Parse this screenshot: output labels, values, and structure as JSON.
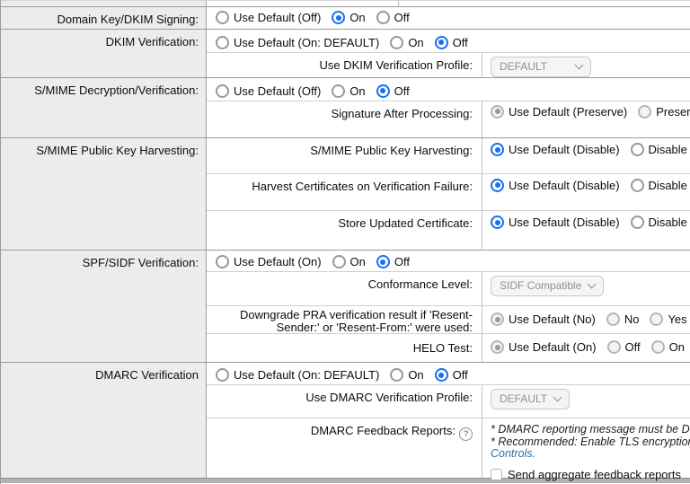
{
  "colors": {
    "accent_blue": "#1670f0",
    "link_blue": "#2a72a8",
    "label_column_bg": "#ececec",
    "disabled_control_text": "#8f8f94"
  },
  "icons": {
    "question": "?"
  },
  "sections": {
    "domain_key": {
      "label": "Domain Key/DKIM Signing:",
      "opt_default": "Use Default (Off)",
      "opt_on": "On",
      "opt_off": "Off",
      "selected": "On"
    },
    "dkim_verification": {
      "label": "DKIM Verification:",
      "opt_default": "Use Default (On: DEFAULT)",
      "opt_on": "On",
      "opt_off": "Off",
      "selected": "Off",
      "profile_label": "Use DKIM Verification Profile:",
      "profile_value": "DEFAULT"
    },
    "smime_decryption": {
      "label": "S/MIME Decryption/Verification:",
      "opt_default": "Use Default (Off)",
      "opt_on": "On",
      "opt_off": "Off",
      "selected": "Off",
      "signature_label": "Signature After Processing:",
      "signature_opt_default": "Use Default (Preserve)",
      "signature_opt_preserve": "Preserve",
      "signature_selected": "Use Default (Preserve)",
      "signature_disabled": true
    },
    "smime_harvesting": {
      "label": "S/MIME Public Key Harvesting:",
      "rows": [
        {
          "label": "S/MIME Public Key Harvesting:",
          "opt_default": "Use Default (Disable)",
          "opt_disable": "Disable",
          "selected": "Use Default (Disable)"
        },
        {
          "label": "Harvest Certificates on Verification Failure:",
          "opt_default": "Use Default (Disable)",
          "opt_disable": "Disable",
          "selected": "Use Default (Disable)"
        },
        {
          "label": "Store Updated Certificate:",
          "opt_default": "Use Default (Disable)",
          "opt_disable": "Disable",
          "selected": "Use Default (Disable)"
        }
      ]
    },
    "spf_sidf": {
      "label": "SPF/SIDF Verification:",
      "opt_default": "Use Default (On)",
      "opt_on": "On",
      "opt_off": "Off",
      "selected": "Off",
      "conformance_label": "Conformance Level:",
      "conformance_value": "SIDF Compatible",
      "pra_label": "Downgrade PRA verification result if 'Resent-Sender:' or 'Resent-From:' were used:",
      "pra_opt_default": "Use Default (No)",
      "pra_opt_no": "No",
      "pra_opt_yes": "Yes",
      "pra_selected": "Use Default (No)",
      "pra_disabled": true,
      "helo_label": "HELO Test:",
      "helo_opt_default": "Use Default (On)",
      "helo_opt_off": "Off",
      "helo_opt_on": "On",
      "helo_selected": "Use Default (On)",
      "helo_disabled": true
    },
    "dmarc": {
      "label": "DMARC Verification",
      "opt_default": "Use Default (On: DEFAULT)",
      "opt_on": "On",
      "opt_off": "Off",
      "selected": "Off",
      "profile_label": "Use DMARC Verification Profile:",
      "profile_value": "DEFAULT",
      "feedback_label": "DMARC Feedback Reports:",
      "note1": "* DMARC reporting message must be DKIM signed.",
      "note2": "* Recommended: Enable TLS encryption in Destination",
      "note_link": "Controls.",
      "checkbox_label": "Send aggregate feedback reports"
    }
  }
}
